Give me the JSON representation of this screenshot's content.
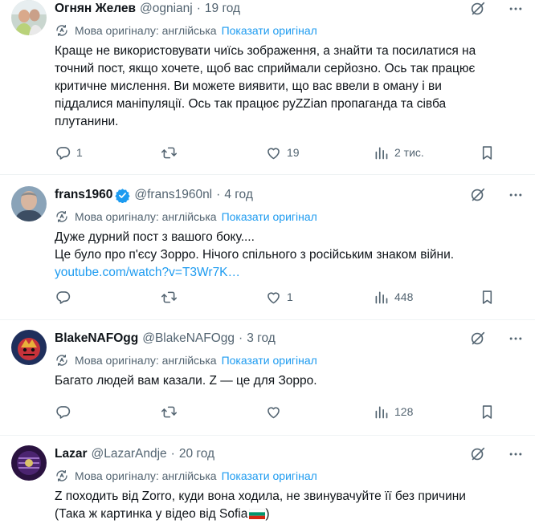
{
  "translate": {
    "label": "Мова оригіналу: англійська",
    "show_original": "Показати оригінал"
  },
  "tweets": [
    {
      "name": "Огнян Желев",
      "handle": "@ognianj",
      "time": "19 год",
      "lines": [
        "Краще не використовувати чиїсь зображення, а знайти та посилатися на",
        "точний пост, якщо хочете, щоб вас сприймали серйозно. Ось так працює",
        "критичне мислення. Ви можете виявити, що вас ввели в оману і ви",
        "піддалися маніпуляції. Ось так працює руZZian пропаганда та сівба",
        "плутанини."
      ],
      "replies": "1",
      "reposts": "",
      "likes": "19",
      "views": "2 тис."
    },
    {
      "name": "frans1960",
      "handle": "@frans1960nl",
      "time": "4 год",
      "verified": true,
      "lines": [
        "Дуже дурний пост з вашого боку....",
        "Це було про п'єсу Зорро. Нічого спільного з російським знаком війни."
      ],
      "link": "youtube.com/watch?v=T3Wr7K…",
      "replies": "",
      "reposts": "",
      "likes": "1",
      "views": "448"
    },
    {
      "name": "BlakeNAFOgg",
      "handle": "@BlakeNAFOgg",
      "time": "3 год",
      "lines": [
        "Багато людей вам казали. Z — це для Зорро."
      ],
      "replies": "",
      "reposts": "",
      "likes": "",
      "views": "128"
    },
    {
      "name": "Lazar",
      "handle": "@LazarAndje",
      "time": "20 год",
      "lines": [
        "Z походить від Zorro, куди вона ходила, не звинувачуйте її без причини",
        "(Така ж картинка у відео від Sofia"
      ]
    }
  ],
  "icons": {
    "reply": "reply-icon",
    "repost": "repost-icon",
    "like": "like-icon",
    "views": "views-icon",
    "bookmark": "bookmark-icon",
    "grok": "grok-icon",
    "more": "more-icon",
    "translate": "translate-icon",
    "verified": "verified-badge-icon",
    "flag": "bulgaria-flag-icon"
  },
  "colors": {
    "link": "#1d9bf0",
    "secondary": "#536471",
    "text": "#0f1419",
    "verified": "#1d9bf0"
  }
}
